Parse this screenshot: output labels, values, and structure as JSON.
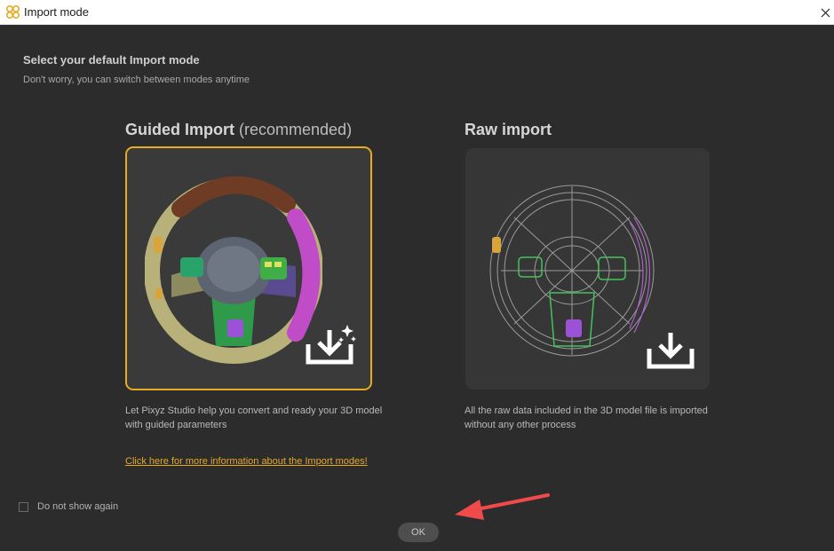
{
  "window": {
    "title": "Import mode",
    "close_glyph": "✕"
  },
  "header": {
    "title": "Select your default Import mode",
    "subtitle": "Don't worry, you can switch between modes anytime"
  },
  "guided": {
    "title": "Guided Import",
    "title_suffix": "(recommended)",
    "description": "Let Pixyz Studio help you convert and ready your 3D model with guided parameters",
    "selected": true
  },
  "raw": {
    "title": "Raw import",
    "description": "All the raw data included in the 3D model file is imported without any other process",
    "selected": false
  },
  "info_link": "Click here for more information about the Import modes!",
  "dont_show": {
    "label": "Do not show again",
    "checked": false
  },
  "ok_button": "OK",
  "colors": {
    "accent": "#e8a923",
    "annotation_arrow": "#f04a4a",
    "background": "#2c2c2c"
  },
  "icons": [
    "pixyz-logo-icon",
    "close-icon",
    "magic-download-icon",
    "download-icon",
    "checkbox",
    "annotation-arrow"
  ]
}
